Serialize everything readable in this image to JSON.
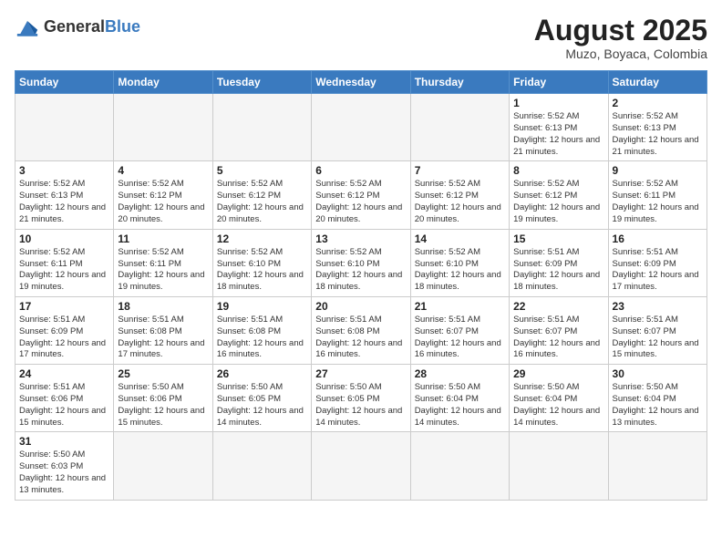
{
  "header": {
    "logo_general": "General",
    "logo_blue": "Blue",
    "month_title": "August 2025",
    "location": "Muzo, Boyaca, Colombia"
  },
  "days_of_week": [
    "Sunday",
    "Monday",
    "Tuesday",
    "Wednesday",
    "Thursday",
    "Friday",
    "Saturday"
  ],
  "weeks": [
    [
      {
        "day": "",
        "info": ""
      },
      {
        "day": "",
        "info": ""
      },
      {
        "day": "",
        "info": ""
      },
      {
        "day": "",
        "info": ""
      },
      {
        "day": "",
        "info": ""
      },
      {
        "day": "1",
        "info": "Sunrise: 5:52 AM\nSunset: 6:13 PM\nDaylight: 12 hours\nand 21 minutes."
      },
      {
        "day": "2",
        "info": "Sunrise: 5:52 AM\nSunset: 6:13 PM\nDaylight: 12 hours\nand 21 minutes."
      }
    ],
    [
      {
        "day": "3",
        "info": "Sunrise: 5:52 AM\nSunset: 6:13 PM\nDaylight: 12 hours\nand 21 minutes."
      },
      {
        "day": "4",
        "info": "Sunrise: 5:52 AM\nSunset: 6:12 PM\nDaylight: 12 hours\nand 20 minutes."
      },
      {
        "day": "5",
        "info": "Sunrise: 5:52 AM\nSunset: 6:12 PM\nDaylight: 12 hours\nand 20 minutes."
      },
      {
        "day": "6",
        "info": "Sunrise: 5:52 AM\nSunset: 6:12 PM\nDaylight: 12 hours\nand 20 minutes."
      },
      {
        "day": "7",
        "info": "Sunrise: 5:52 AM\nSunset: 6:12 PM\nDaylight: 12 hours\nand 20 minutes."
      },
      {
        "day": "8",
        "info": "Sunrise: 5:52 AM\nSunset: 6:12 PM\nDaylight: 12 hours\nand 19 minutes."
      },
      {
        "day": "9",
        "info": "Sunrise: 5:52 AM\nSunset: 6:11 PM\nDaylight: 12 hours\nand 19 minutes."
      }
    ],
    [
      {
        "day": "10",
        "info": "Sunrise: 5:52 AM\nSunset: 6:11 PM\nDaylight: 12 hours\nand 19 minutes."
      },
      {
        "day": "11",
        "info": "Sunrise: 5:52 AM\nSunset: 6:11 PM\nDaylight: 12 hours\nand 19 minutes."
      },
      {
        "day": "12",
        "info": "Sunrise: 5:52 AM\nSunset: 6:10 PM\nDaylight: 12 hours\nand 18 minutes."
      },
      {
        "day": "13",
        "info": "Sunrise: 5:52 AM\nSunset: 6:10 PM\nDaylight: 12 hours\nand 18 minutes."
      },
      {
        "day": "14",
        "info": "Sunrise: 5:52 AM\nSunset: 6:10 PM\nDaylight: 12 hours\nand 18 minutes."
      },
      {
        "day": "15",
        "info": "Sunrise: 5:51 AM\nSunset: 6:09 PM\nDaylight: 12 hours\nand 18 minutes."
      },
      {
        "day": "16",
        "info": "Sunrise: 5:51 AM\nSunset: 6:09 PM\nDaylight: 12 hours\nand 17 minutes."
      }
    ],
    [
      {
        "day": "17",
        "info": "Sunrise: 5:51 AM\nSunset: 6:09 PM\nDaylight: 12 hours\nand 17 minutes."
      },
      {
        "day": "18",
        "info": "Sunrise: 5:51 AM\nSunset: 6:08 PM\nDaylight: 12 hours\nand 17 minutes."
      },
      {
        "day": "19",
        "info": "Sunrise: 5:51 AM\nSunset: 6:08 PM\nDaylight: 12 hours\nand 16 minutes."
      },
      {
        "day": "20",
        "info": "Sunrise: 5:51 AM\nSunset: 6:08 PM\nDaylight: 12 hours\nand 16 minutes."
      },
      {
        "day": "21",
        "info": "Sunrise: 5:51 AM\nSunset: 6:07 PM\nDaylight: 12 hours\nand 16 minutes."
      },
      {
        "day": "22",
        "info": "Sunrise: 5:51 AM\nSunset: 6:07 PM\nDaylight: 12 hours\nand 16 minutes."
      },
      {
        "day": "23",
        "info": "Sunrise: 5:51 AM\nSunset: 6:07 PM\nDaylight: 12 hours\nand 15 minutes."
      }
    ],
    [
      {
        "day": "24",
        "info": "Sunrise: 5:51 AM\nSunset: 6:06 PM\nDaylight: 12 hours\nand 15 minutes."
      },
      {
        "day": "25",
        "info": "Sunrise: 5:50 AM\nSunset: 6:06 PM\nDaylight: 12 hours\nand 15 minutes."
      },
      {
        "day": "26",
        "info": "Sunrise: 5:50 AM\nSunset: 6:05 PM\nDaylight: 12 hours\nand 14 minutes."
      },
      {
        "day": "27",
        "info": "Sunrise: 5:50 AM\nSunset: 6:05 PM\nDaylight: 12 hours\nand 14 minutes."
      },
      {
        "day": "28",
        "info": "Sunrise: 5:50 AM\nSunset: 6:04 PM\nDaylight: 12 hours\nand 14 minutes."
      },
      {
        "day": "29",
        "info": "Sunrise: 5:50 AM\nSunset: 6:04 PM\nDaylight: 12 hours\nand 14 minutes."
      },
      {
        "day": "30",
        "info": "Sunrise: 5:50 AM\nSunset: 6:04 PM\nDaylight: 12 hours\nand 13 minutes."
      }
    ],
    [
      {
        "day": "31",
        "info": "Sunrise: 5:50 AM\nSunset: 6:03 PM\nDaylight: 12 hours\nand 13 minutes."
      },
      {
        "day": "",
        "info": ""
      },
      {
        "day": "",
        "info": ""
      },
      {
        "day": "",
        "info": ""
      },
      {
        "day": "",
        "info": ""
      },
      {
        "day": "",
        "info": ""
      },
      {
        "day": "",
        "info": ""
      }
    ]
  ]
}
